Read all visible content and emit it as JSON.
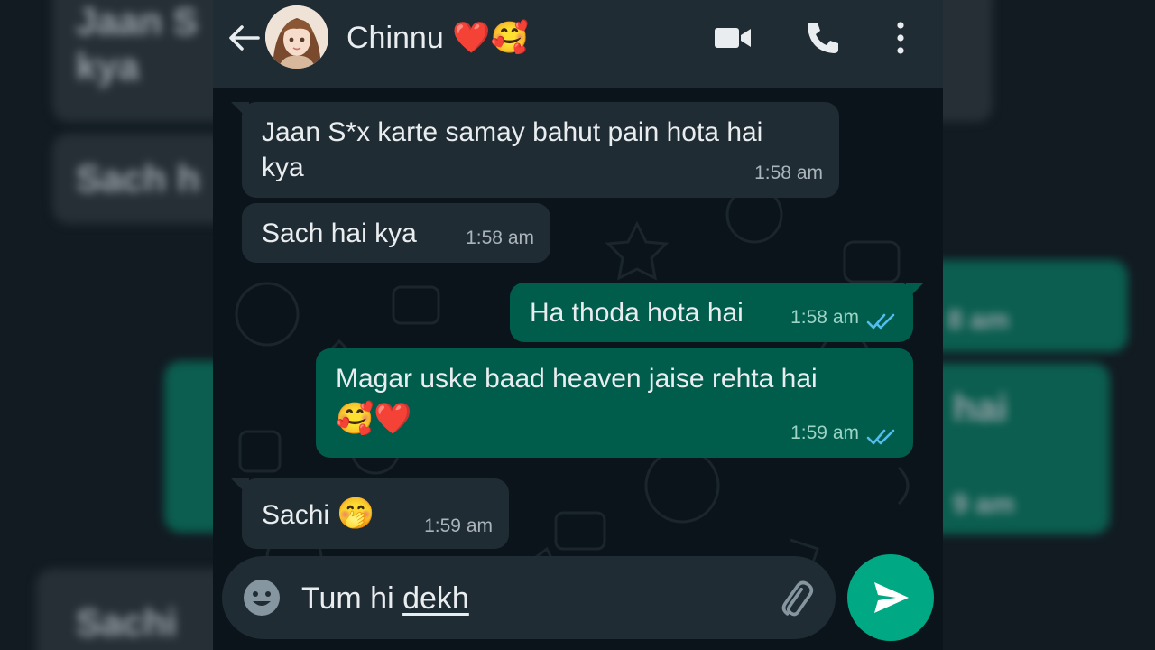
{
  "header": {
    "contact_name": "Chinnu",
    "contact_emoji": "❤️🥰"
  },
  "messages": [
    {
      "direction": "in",
      "text": "Jaan S*x karte samay bahut pain hota hai kya",
      "line1": "Jaan S*x karte samay bahut pain hota hai",
      "line2": "kya",
      "time": "1:58 am"
    },
    {
      "direction": "in",
      "text": "Sach hai kya",
      "time": "1:58 am"
    },
    {
      "direction": "out",
      "text": "Ha thoda hota hai",
      "time": "1:58 am",
      "status": "read"
    },
    {
      "direction": "out",
      "line1": "Magar uske baad heaven jaise rehta hai",
      "line2": "🥰❤️",
      "time": "1:59 am",
      "status": "read"
    },
    {
      "direction": "in",
      "text": "Sachi",
      "emoji": "🤭",
      "time": "1:59 am"
    }
  ],
  "composer": {
    "value_plain": "Tum hi ",
    "value_underlined": "dekh"
  },
  "backdrop": {
    "left_texts": [
      "Jaan S",
      "kya",
      "Sach h",
      "Sachi"
    ],
    "right_texts": [
      "8 am",
      "hai",
      "9 am"
    ]
  },
  "colors": {
    "header_bg": "#1f2c34",
    "incoming_bubble": "#202c33",
    "outgoing_bubble": "#005c4b",
    "send_button": "#00a884",
    "read_ticks": "#53bdeb"
  },
  "icons": [
    "back-arrow-icon",
    "video-call-icon",
    "phone-icon",
    "more-options-icon",
    "emoji-icon",
    "attach-icon",
    "send-icon",
    "double-check-icon"
  ]
}
